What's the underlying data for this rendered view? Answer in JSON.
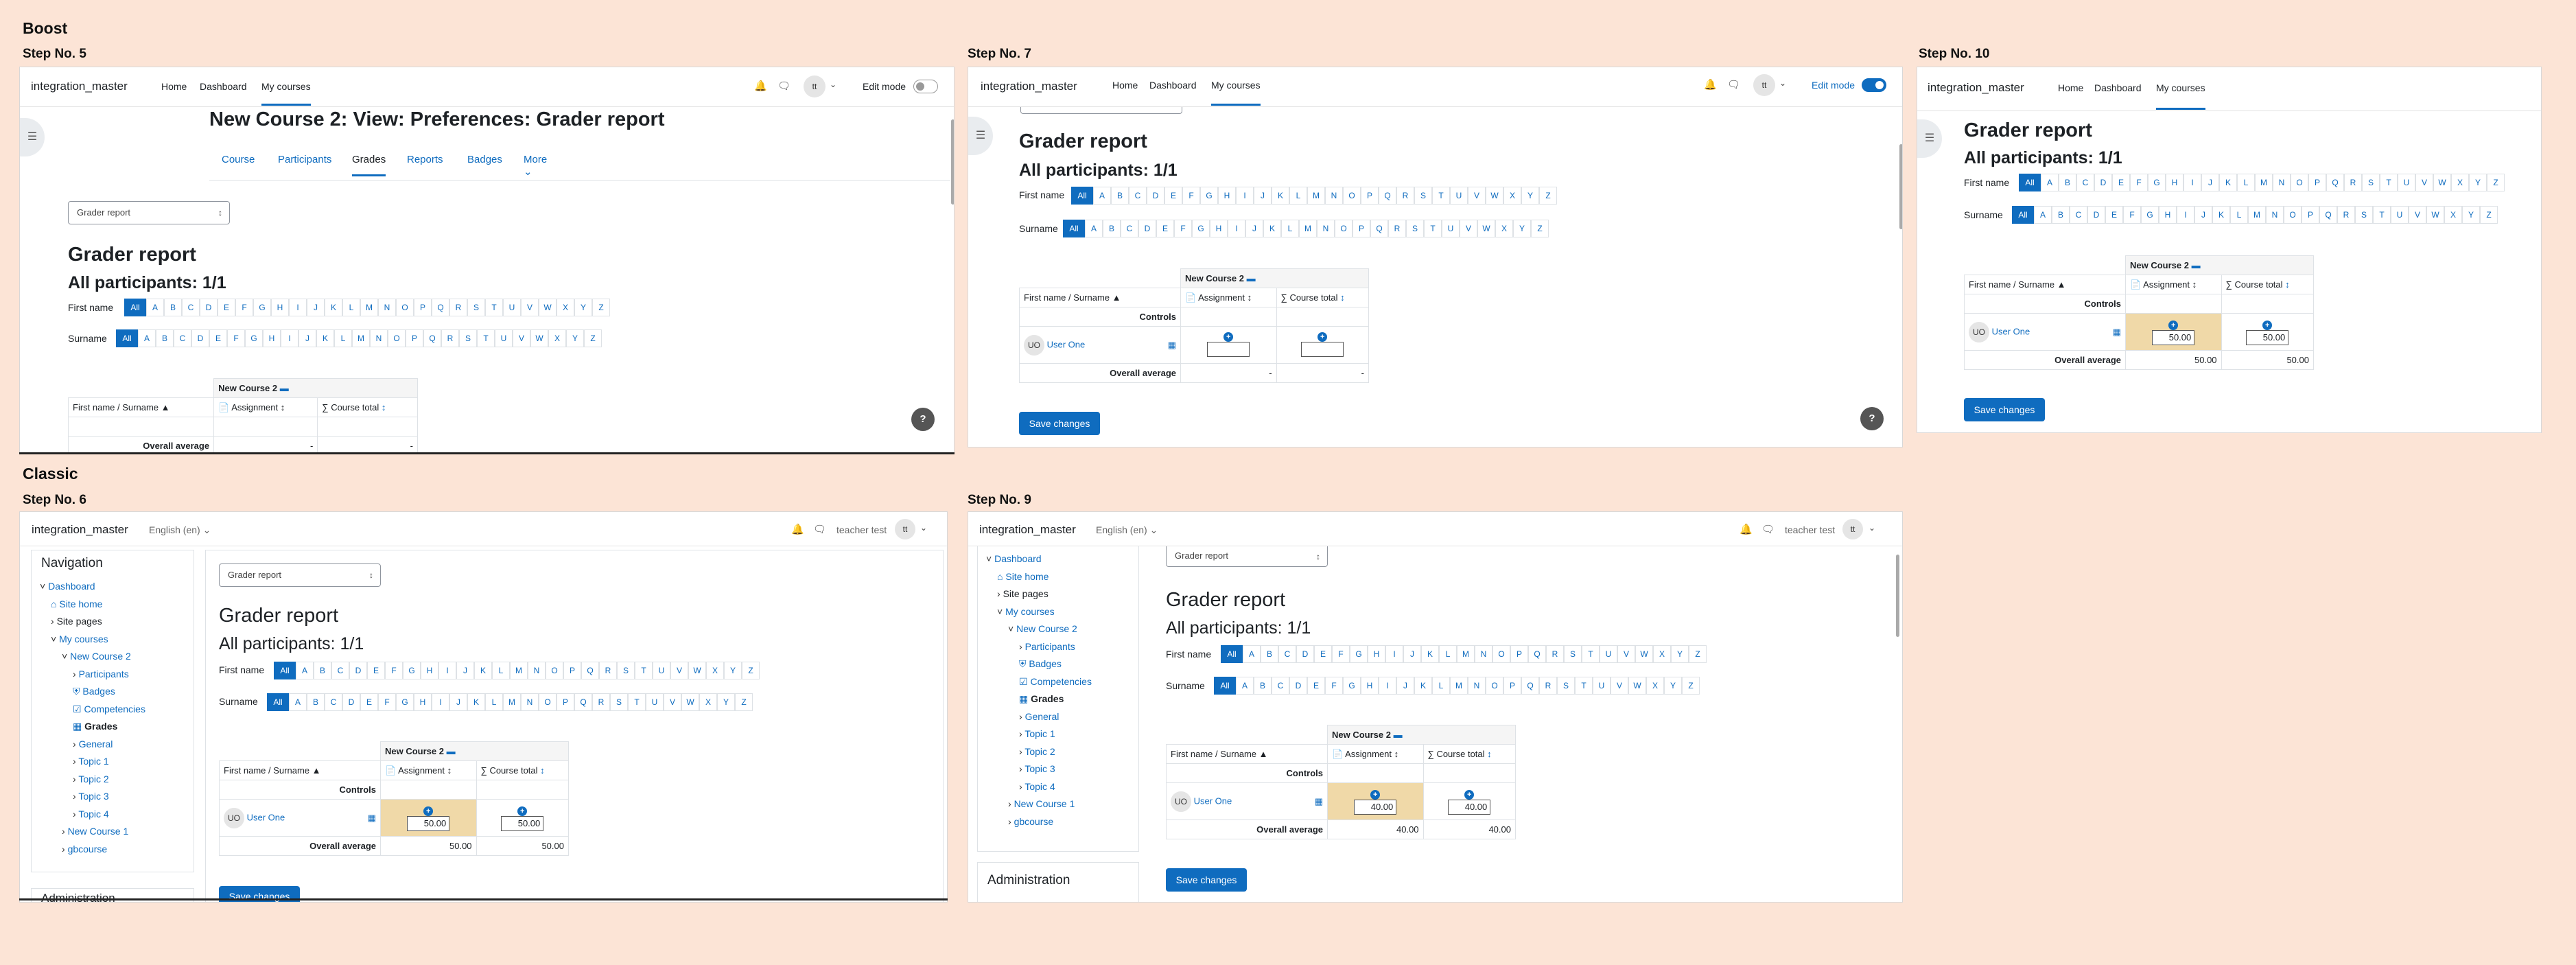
{
  "boost_label": "Boost",
  "classic_label": "Classic",
  "common": {
    "site_name": "integration_master",
    "home": "Home",
    "dashboard": "Dashboard",
    "my_courses": "My courses",
    "edit_mode": "Edit mode",
    "avatar_initials": "tt",
    "grader_report": "Grader report",
    "all_participants": "All participants: 1/1",
    "first_name_label": "First name",
    "surname_label": "Surname",
    "all": "All",
    "letters": [
      "A",
      "B",
      "C",
      "D",
      "E",
      "F",
      "G",
      "H",
      "I",
      "J",
      "K",
      "L",
      "M",
      "N",
      "O",
      "P",
      "Q",
      "R",
      "S",
      "T",
      "U",
      "V",
      "W",
      "X",
      "Y",
      "Z"
    ],
    "course_header": "New Course 2",
    "first_name_col": "First name",
    "slash": " / ",
    "surname_col": "Surname",
    "assignment": "Assignment",
    "course_total": "Course total",
    "controls": "Controls",
    "user_initials": "UO",
    "user_name": "User One",
    "overall_average": "Overall average",
    "save_changes": "Save changes",
    "help": "?",
    "language": "English (en)",
    "teacher": "teacher test"
  },
  "step5": {
    "label": "Step No. 5",
    "page_title": "New Course 2: View: Preferences: Grader report",
    "tabs": [
      "Course",
      "Participants",
      "Grades",
      "Reports",
      "Badges",
      "More"
    ],
    "select_value": "Grader report",
    "avg_assignment": "-",
    "avg_total": "-"
  },
  "step7": {
    "label": "Step No. 7",
    "avg_assignment": "-",
    "avg_total": "-"
  },
  "step10": {
    "label": "Step No. 10",
    "assignment_value": "50.00",
    "total_value": "50.00",
    "avg_assignment": "50.00",
    "avg_total": "50.00"
  },
  "step6": {
    "label": "Step No. 6",
    "navigation": "Navigation",
    "administration": "Administration",
    "tree": [
      "Dashboard",
      "Site home",
      "Site pages",
      "My courses",
      "New Course 2",
      "Participants",
      "Badges",
      "Competencies",
      "Grades",
      "General",
      "Topic 1",
      "Topic 2",
      "Topic 3",
      "Topic 4",
      "New Course 1",
      "gbcourse"
    ],
    "select_value": "Grader report",
    "assignment_value": "50.00",
    "total_value": "50.00",
    "avg_assignment": "50.00",
    "avg_total": "50.00"
  },
  "step9": {
    "label": "Step No. 9",
    "administration": "Administration",
    "tree": [
      "Dashboard",
      "Site home",
      "Site pages",
      "My courses",
      "New Course 2",
      "Participants",
      "Badges",
      "Competencies",
      "Grades",
      "General",
      "Topic 1",
      "Topic 2",
      "Topic 3",
      "Topic 4",
      "New Course 1",
      "gbcourse"
    ],
    "select_value": "Grader report",
    "assignment_value": "40.00",
    "total_value": "40.00",
    "avg_assignment": "40.00",
    "avg_total": "40.00"
  }
}
